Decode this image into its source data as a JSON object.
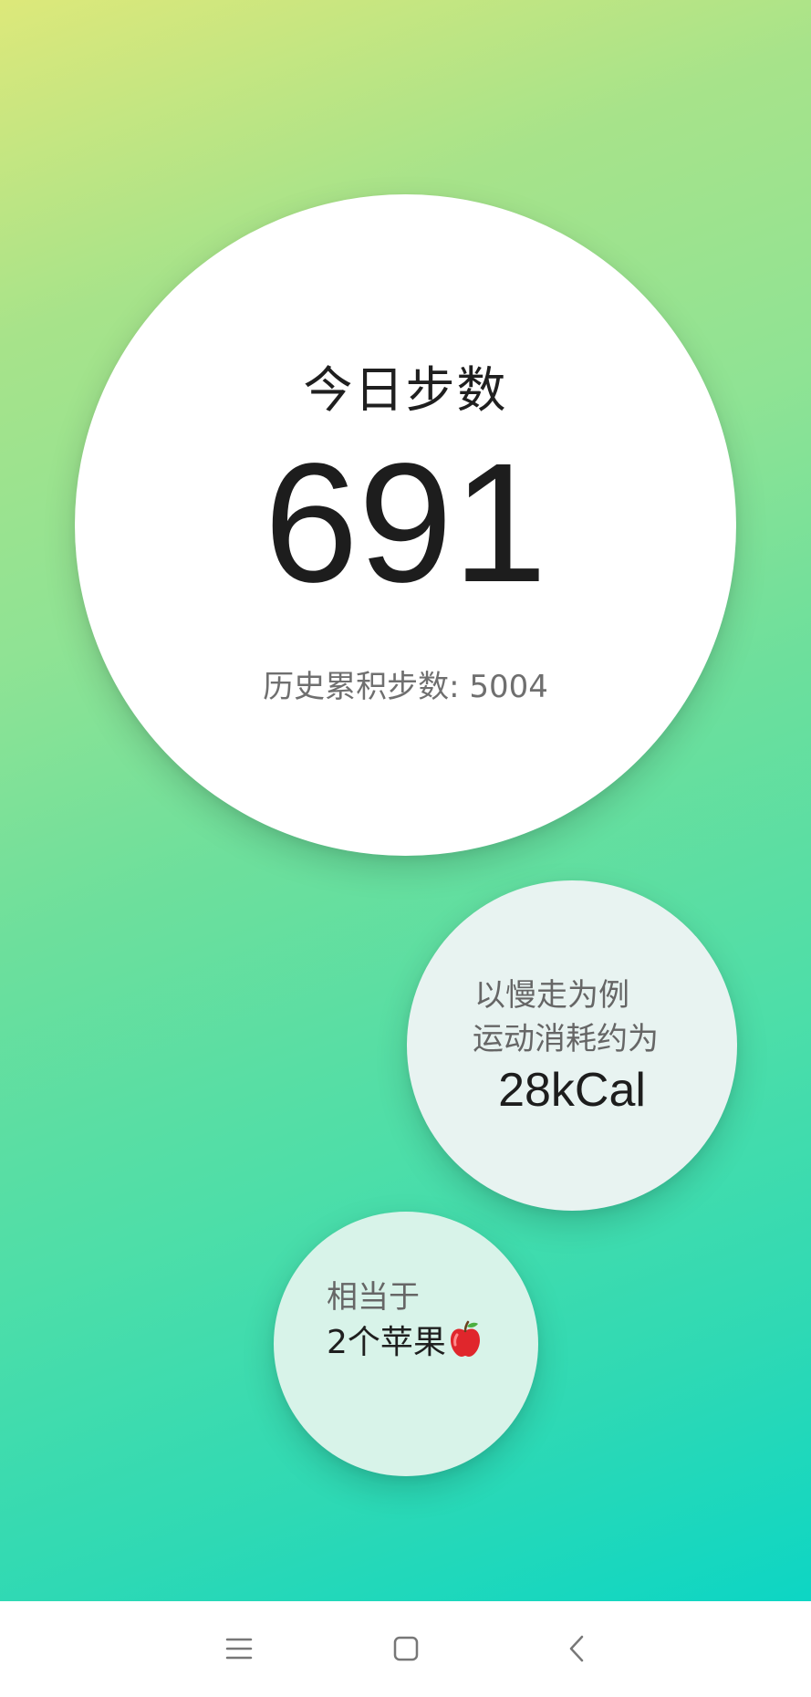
{
  "today_steps": {
    "title": "今日步数",
    "value": "691",
    "history_label": "历史累积步数: 5004"
  },
  "calorie": {
    "line1": "以慢走为例",
    "line2": "运动消耗约为",
    "value": "28kCal"
  },
  "apple": {
    "line1": "相当于",
    "line2": "2个苹果",
    "icon": "red-apple-icon"
  },
  "nav_bar": {
    "buttons": [
      "menu-icon",
      "home-square-icon",
      "back-chevron-icon"
    ]
  },
  "colors": {
    "gradient_top": "#dde87a",
    "gradient_bottom": "#0dd6c4",
    "circle_main": "#ffffff",
    "circle_calorie": "#e8f3f1",
    "circle_apple": "#d8f3e9",
    "text_dark": "#1d1d1d",
    "text_gray": "#6f6f6f"
  }
}
